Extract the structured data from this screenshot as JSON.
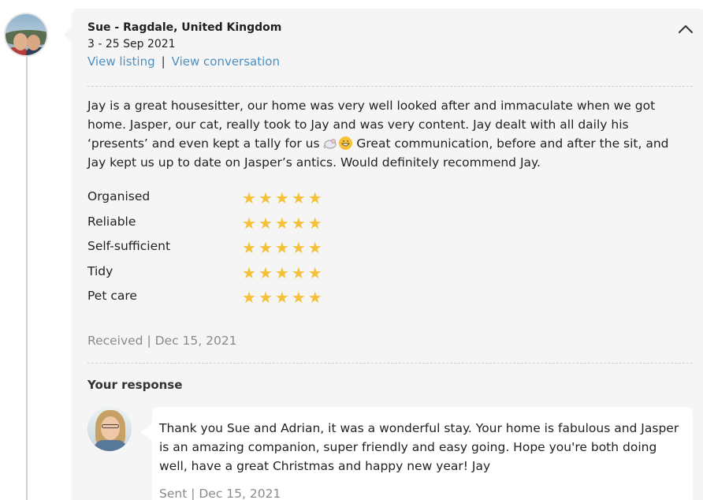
{
  "review": {
    "reviewer": "Sue - Ragdale, United Kingdom",
    "dates": "3 - 25 Sep 2021",
    "view_listing": "View listing",
    "separator": "|",
    "view_conversation": "View conversation",
    "text_before_emoji": "Jay is a great housesitter, our home was very well looked after and immaculate when we got home. Jasper, our cat, really took to Jay and was very content. Jay dealt with all daily his ‘presents’ and even kept a tally for us ",
    "text_after_emoji": " Great communication, before and after the sit, and Jay kept us up to date on Jasper’s antics. Would definitely recommend Jay.",
    "emojis": [
      "mouse-emoji",
      "grinning-face-emoji"
    ],
    "ratings": [
      {
        "label": "Organised",
        "stars": 5
      },
      {
        "label": "Reliable",
        "stars": 5
      },
      {
        "label": "Self-sufficient",
        "stars": 5
      },
      {
        "label": "Tidy",
        "stars": 5
      },
      {
        "label": "Pet care",
        "stars": 5
      }
    ],
    "max_stars": 5,
    "received": "Received | Dec 15, 2021"
  },
  "response": {
    "heading": "Your response",
    "text": "Thank you Sue and Adrian, it was a wonderful stay. Your home is fabulous and Jasper is an amazing companion, super friendly and easy going. Hope you're both doing well, have a great Christmas and happy new year! Jay",
    "sent": "Sent | Dec 15, 2021"
  },
  "colors": {
    "card_bg": "#f5f5f5",
    "link": "#4a90c4",
    "star": "#f5c13a",
    "muted_text": "#8a8a8a"
  },
  "icons": {
    "collapse": "chevron-up-icon",
    "star": "star-icon"
  }
}
